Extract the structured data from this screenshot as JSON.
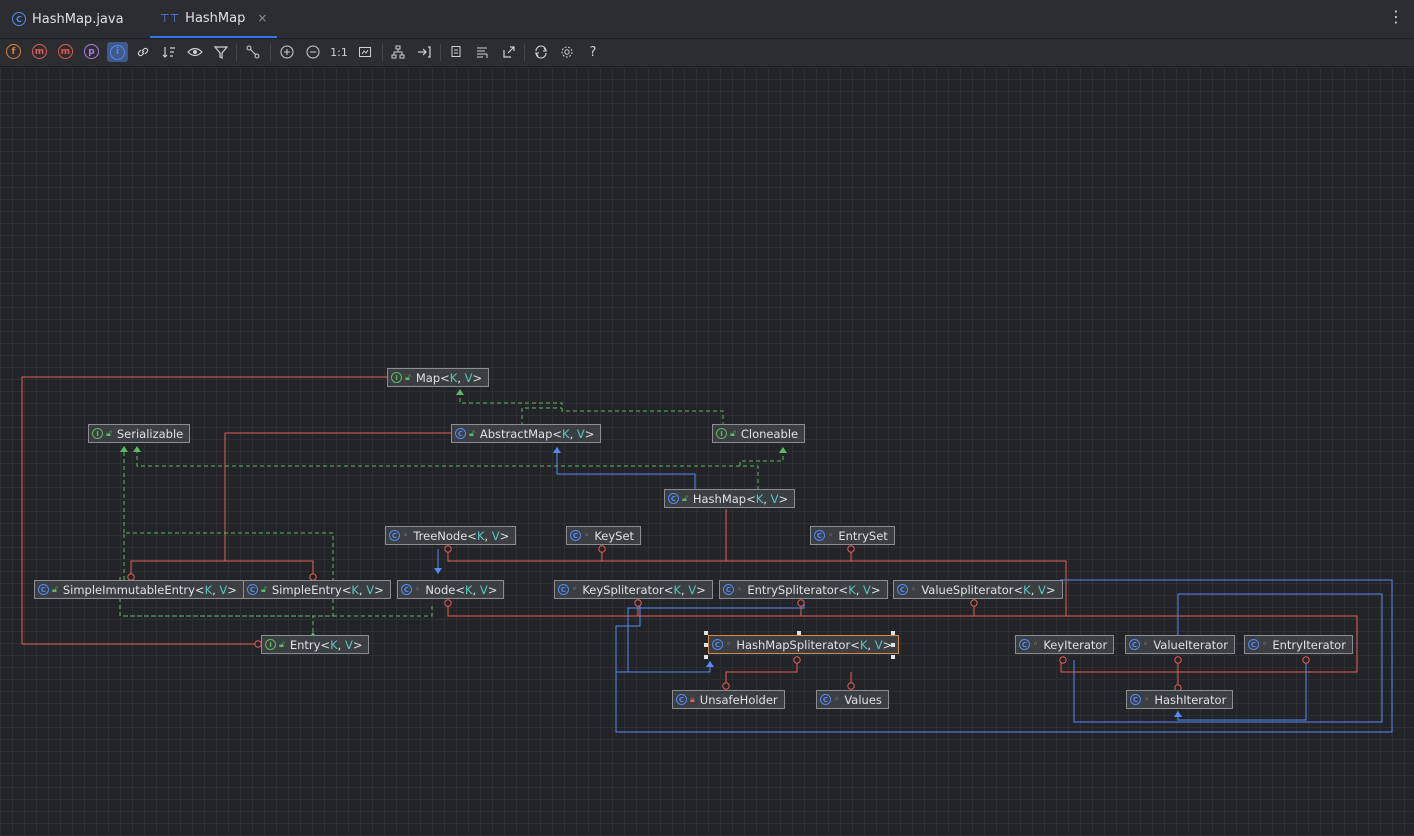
{
  "tabs": [
    {
      "label": "HashMap.java",
      "icon": "class-icon",
      "active": false
    },
    {
      "label": "HashMap",
      "icon": "diagram-icon",
      "active": true
    }
  ],
  "tab_close": "×",
  "menu": "⋮",
  "toolbar": {
    "fields": "f",
    "constructors": "m",
    "methods": "m",
    "properties": "p",
    "inners": "i",
    "zoom_actual": "1:1",
    "help": "?"
  },
  "generic": {
    "k": "K",
    "v": "V",
    "comma": ", ",
    "open": "<",
    "close": ">"
  },
  "nodes": {
    "map": "Map",
    "serializable": "Serializable",
    "abstractmap": "AbstractMap",
    "cloneable": "Cloneable",
    "hashmap": "HashMap",
    "treenode": "TreeNode",
    "keyset": "KeySet",
    "entryset": "EntrySet",
    "simpleimmutableentry": "SimpleImmutableEntry",
    "simpleentry": "SimpleEntry",
    "node": "Node",
    "keyspliterator": "KeySpliterator",
    "entryspliterator": "EntrySpliterator",
    "valuespliterator": "ValueSpliterator",
    "entry": "Entry",
    "hashmapspliterator": "HashMapSpliterator",
    "keyiterator": "KeyIterator",
    "valueiterator": "ValueIterator",
    "entryiterator": "EntryIterator",
    "unsafeholder": "UnsafeHolder",
    "values": "Values",
    "hashiterator": "HashIterator"
  },
  "colors": {
    "inner_edge": "#e35e57",
    "extends_edge": "#548af7",
    "implements_edge": "#5fb865",
    "selection": "#d18f4b"
  }
}
